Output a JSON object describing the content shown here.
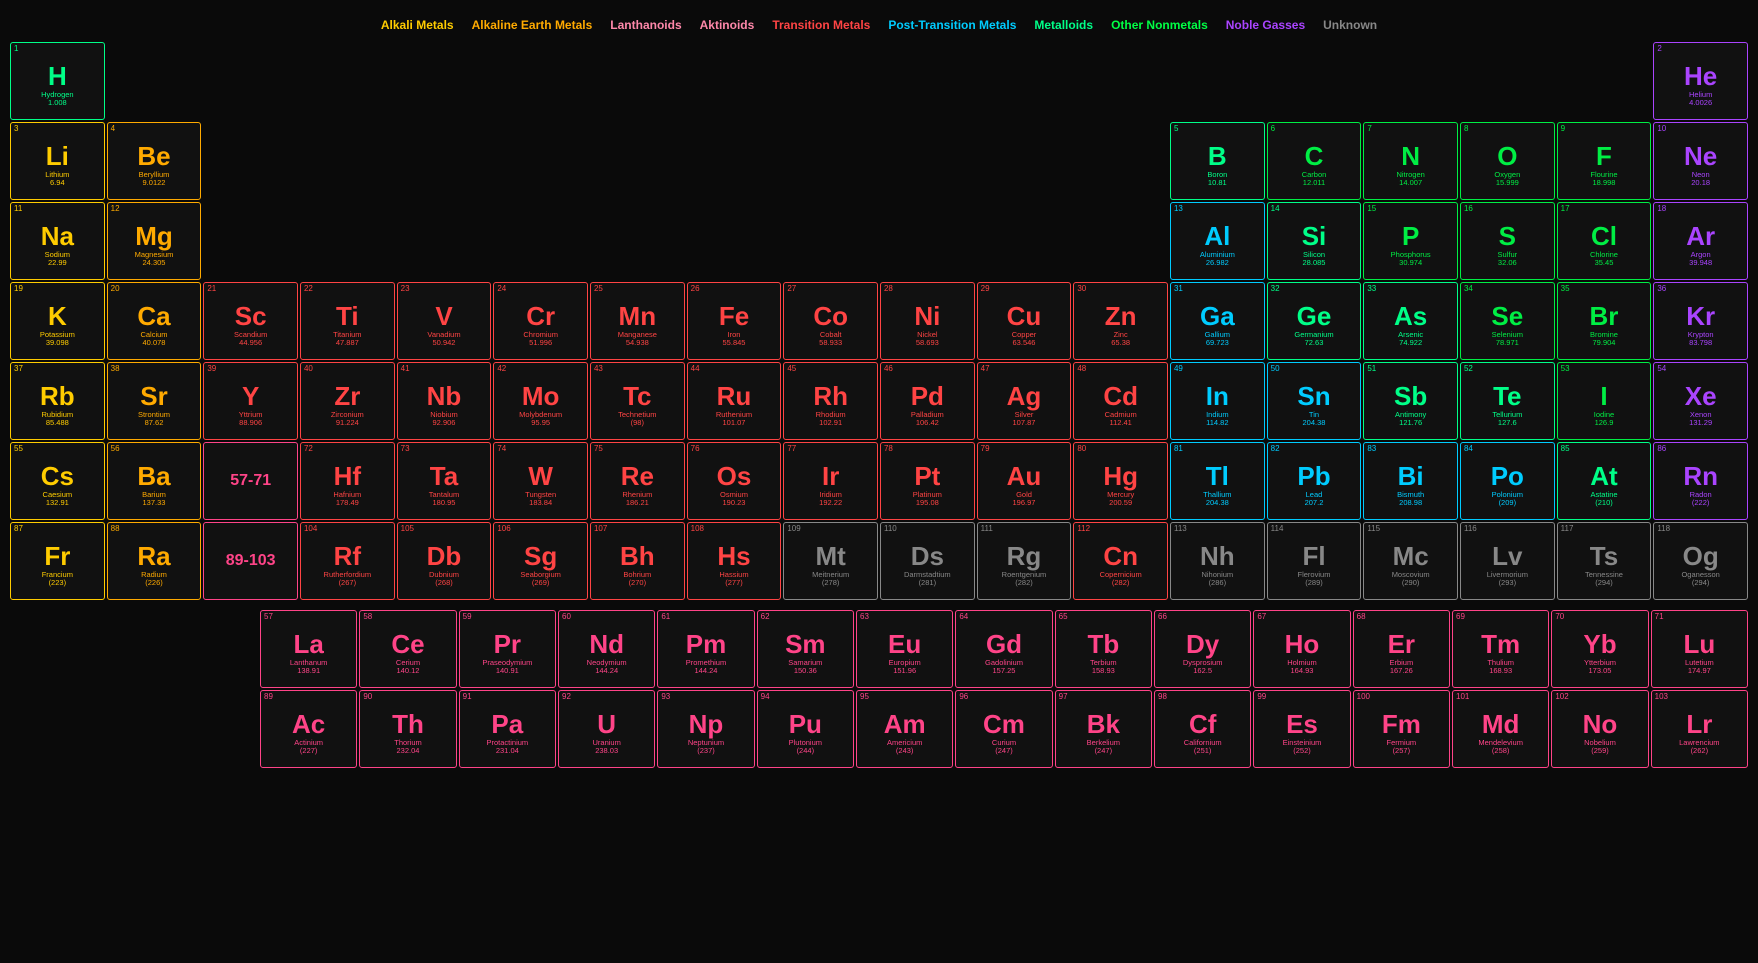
{
  "legend": {
    "items": [
      {
        "label": "Alkali Metals",
        "color": "#ffcc00",
        "key": "alkali"
      },
      {
        "label": "Alkaline Earth Metals",
        "color": "#ffaa00",
        "key": "alkali-earth"
      },
      {
        "label": "Lanthanoids",
        "color": "#ff88aa",
        "key": "lanthanoid"
      },
      {
        "label": "Aktinoids",
        "color": "#ff88aa",
        "key": "actinoid"
      },
      {
        "label": "Transition Metals",
        "color": "#ff4444",
        "key": "transition"
      },
      {
        "label": "Post-Transition Metals",
        "color": "#00ccff",
        "key": "post-transition"
      },
      {
        "label": "Metalloids",
        "color": "#00ff88",
        "key": "metalloid"
      },
      {
        "label": "Other Nonmetals",
        "color": "#00ff44",
        "key": "nonmetal"
      },
      {
        "label": "Noble Gasses",
        "color": "#aa44ff",
        "key": "noble"
      },
      {
        "label": "Unknown",
        "color": "#888888",
        "key": "unknown"
      }
    ]
  },
  "elements": [
    {
      "num": 1,
      "sym": "H",
      "name": "Hydrogen",
      "mass": "1.008",
      "cat": "hydrogen",
      "col": 1,
      "row": 1
    },
    {
      "num": 2,
      "sym": "He",
      "name": "Helium",
      "mass": "4.0026",
      "cat": "noble",
      "col": 18,
      "row": 1
    },
    {
      "num": 3,
      "sym": "Li",
      "name": "Lithium",
      "mass": "6.94",
      "cat": "alkali",
      "col": 1,
      "row": 2
    },
    {
      "num": 4,
      "sym": "Be",
      "name": "Beryllium",
      "mass": "9.0122",
      "cat": "alkali-earth",
      "col": 2,
      "row": 2
    },
    {
      "num": 5,
      "sym": "B",
      "name": "Boron",
      "mass": "10.81",
      "cat": "metalloid",
      "col": 13,
      "row": 2
    },
    {
      "num": 6,
      "sym": "C",
      "name": "Carbon",
      "mass": "12.011",
      "cat": "nonmetal",
      "col": 14,
      "row": 2
    },
    {
      "num": 7,
      "sym": "N",
      "name": "Nitrogen",
      "mass": "14.007",
      "cat": "nonmetal",
      "col": 15,
      "row": 2
    },
    {
      "num": 8,
      "sym": "O",
      "name": "Oxygen",
      "mass": "15.999",
      "cat": "nonmetal",
      "col": 16,
      "row": 2
    },
    {
      "num": 9,
      "sym": "F",
      "name": "Flourine",
      "mass": "18.998",
      "cat": "nonmetal",
      "col": 17,
      "row": 2
    },
    {
      "num": 10,
      "sym": "Ne",
      "name": "Neon",
      "mass": "20.18",
      "cat": "noble",
      "col": 18,
      "row": 2
    },
    {
      "num": 11,
      "sym": "Na",
      "name": "Sodium",
      "mass": "22.99",
      "cat": "alkali",
      "col": 1,
      "row": 3
    },
    {
      "num": 12,
      "sym": "Mg",
      "name": "Magnesium",
      "mass": "24.305",
      "cat": "alkali-earth",
      "col": 2,
      "row": 3
    },
    {
      "num": 13,
      "sym": "Al",
      "name": "Aluminium",
      "mass": "26.982",
      "cat": "post-transition",
      "col": 13,
      "row": 3
    },
    {
      "num": 14,
      "sym": "Si",
      "name": "Silicon",
      "mass": "28.085",
      "cat": "metalloid",
      "col": 14,
      "row": 3
    },
    {
      "num": 15,
      "sym": "P",
      "name": "Phosphorus",
      "mass": "30.974",
      "cat": "nonmetal",
      "col": 15,
      "row": 3
    },
    {
      "num": 16,
      "sym": "S",
      "name": "Sulfur",
      "mass": "32.06",
      "cat": "nonmetal",
      "col": 16,
      "row": 3
    },
    {
      "num": 17,
      "sym": "Cl",
      "name": "Chlorine",
      "mass": "35.45",
      "cat": "nonmetal",
      "col": 17,
      "row": 3
    },
    {
      "num": 18,
      "sym": "Ar",
      "name": "Argon",
      "mass": "39.948",
      "cat": "noble",
      "col": 18,
      "row": 3
    },
    {
      "num": 19,
      "sym": "K",
      "name": "Potassium",
      "mass": "39.098",
      "cat": "alkali",
      "col": 1,
      "row": 4
    },
    {
      "num": 20,
      "sym": "Ca",
      "name": "Calcium",
      "mass": "40.078",
      "cat": "alkali-earth",
      "col": 2,
      "row": 4
    },
    {
      "num": 21,
      "sym": "Sc",
      "name": "Scandium",
      "mass": "44.956",
      "cat": "transition",
      "col": 3,
      "row": 4
    },
    {
      "num": 22,
      "sym": "Ti",
      "name": "Titanium",
      "mass": "47.887",
      "cat": "transition",
      "col": 4,
      "row": 4
    },
    {
      "num": 23,
      "sym": "V",
      "name": "Vanadium",
      "mass": "50.942",
      "cat": "transition",
      "col": 5,
      "row": 4
    },
    {
      "num": 24,
      "sym": "Cr",
      "name": "Chromium",
      "mass": "51.996",
      "cat": "transition",
      "col": 6,
      "row": 4
    },
    {
      "num": 25,
      "sym": "Mn",
      "name": "Manganese",
      "mass": "54.938",
      "cat": "transition",
      "col": 7,
      "row": 4
    },
    {
      "num": 26,
      "sym": "Fe",
      "name": "Iron",
      "mass": "55.845",
      "cat": "transition",
      "col": 8,
      "row": 4
    },
    {
      "num": 27,
      "sym": "Co",
      "name": "Cobalt",
      "mass": "58.933",
      "cat": "transition",
      "col": 9,
      "row": 4
    },
    {
      "num": 28,
      "sym": "Ni",
      "name": "Nickel",
      "mass": "58.693",
      "cat": "transition",
      "col": 10,
      "row": 4
    },
    {
      "num": 29,
      "sym": "Cu",
      "name": "Copper",
      "mass": "63.546",
      "cat": "transition",
      "col": 11,
      "row": 4
    },
    {
      "num": 30,
      "sym": "Zn",
      "name": "Zinc",
      "mass": "65.38",
      "cat": "transition",
      "col": 12,
      "row": 4
    },
    {
      "num": 31,
      "sym": "Ga",
      "name": "Gallium",
      "mass": "69.723",
      "cat": "post-transition",
      "col": 13,
      "row": 4
    },
    {
      "num": 32,
      "sym": "Ge",
      "name": "Germanium",
      "mass": "72.63",
      "cat": "metalloid",
      "col": 14,
      "row": 4
    },
    {
      "num": 33,
      "sym": "As",
      "name": "Arsenic",
      "mass": "74.922",
      "cat": "metalloid",
      "col": 15,
      "row": 4
    },
    {
      "num": 34,
      "sym": "Se",
      "name": "Selenium",
      "mass": "78.971",
      "cat": "nonmetal",
      "col": 16,
      "row": 4
    },
    {
      "num": 35,
      "sym": "Br",
      "name": "Bromine",
      "mass": "79.904",
      "cat": "nonmetal",
      "col": 17,
      "row": 4
    },
    {
      "num": 36,
      "sym": "Kr",
      "name": "Krypton",
      "mass": "83.798",
      "cat": "noble",
      "col": 18,
      "row": 4
    },
    {
      "num": 37,
      "sym": "Rb",
      "name": "Rubidium",
      "mass": "85.488",
      "cat": "alkali",
      "col": 1,
      "row": 5
    },
    {
      "num": 38,
      "sym": "Sr",
      "name": "Strontium",
      "mass": "87.62",
      "cat": "alkali-earth",
      "col": 2,
      "row": 5
    },
    {
      "num": 39,
      "sym": "Y",
      "name": "Yttrium",
      "mass": "88.906",
      "cat": "transition",
      "col": 3,
      "row": 5
    },
    {
      "num": 40,
      "sym": "Zr",
      "name": "Zirconium",
      "mass": "91.224",
      "cat": "transition",
      "col": 4,
      "row": 5
    },
    {
      "num": 41,
      "sym": "Nb",
      "name": "Niobium",
      "mass": "92.906",
      "cat": "transition",
      "col": 5,
      "row": 5
    },
    {
      "num": 42,
      "sym": "Mo",
      "name": "Molybdenum",
      "mass": "95.95",
      "cat": "transition",
      "col": 6,
      "row": 5
    },
    {
      "num": 43,
      "sym": "Tc",
      "name": "Technetium",
      "mass": "(98)",
      "cat": "transition",
      "col": 7,
      "row": 5
    },
    {
      "num": 44,
      "sym": "Ru",
      "name": "Ruthenium",
      "mass": "101.07",
      "cat": "transition",
      "col": 8,
      "row": 5
    },
    {
      "num": 45,
      "sym": "Rh",
      "name": "Rhodium",
      "mass": "102.91",
      "cat": "transition",
      "col": 9,
      "row": 5
    },
    {
      "num": 46,
      "sym": "Pd",
      "name": "Palladium",
      "mass": "106.42",
      "cat": "transition",
      "col": 10,
      "row": 5
    },
    {
      "num": 47,
      "sym": "Ag",
      "name": "Silver",
      "mass": "107.87",
      "cat": "transition",
      "col": 11,
      "row": 5
    },
    {
      "num": 48,
      "sym": "Cd",
      "name": "Cadmium",
      "mass": "112.41",
      "cat": "transition",
      "col": 12,
      "row": 5
    },
    {
      "num": 49,
      "sym": "In",
      "name": "Indium",
      "mass": "114.82",
      "cat": "post-transition",
      "col": 13,
      "row": 5
    },
    {
      "num": 50,
      "sym": "Sn",
      "name": "Tin",
      "mass": "204.38",
      "cat": "post-transition",
      "col": 14,
      "row": 5
    },
    {
      "num": 51,
      "sym": "Sb",
      "name": "Antimony",
      "mass": "121.76",
      "cat": "metalloid",
      "col": 15,
      "row": 5
    },
    {
      "num": 52,
      "sym": "Te",
      "name": "Tellurium",
      "mass": "127.6",
      "cat": "metalloid",
      "col": 16,
      "row": 5
    },
    {
      "num": 53,
      "sym": "I",
      "name": "Iodine",
      "mass": "126.9",
      "cat": "nonmetal",
      "col": 17,
      "row": 5
    },
    {
      "num": 54,
      "sym": "Xe",
      "name": "Xenon",
      "mass": "131.29",
      "cat": "noble",
      "col": 18,
      "row": 5
    },
    {
      "num": 55,
      "sym": "Cs",
      "name": "Caesium",
      "mass": "132.91",
      "cat": "alkali",
      "col": 1,
      "row": 6
    },
    {
      "num": 56,
      "sym": "Ba",
      "name": "Barium",
      "mass": "137.33",
      "cat": "alkali-earth",
      "col": 2,
      "row": 6
    },
    {
      "num": 72,
      "sym": "Hf",
      "name": "Hafnium",
      "mass": "178.49",
      "cat": "transition",
      "col": 4,
      "row": 6
    },
    {
      "num": 73,
      "sym": "Ta",
      "name": "Tantalum",
      "mass": "180.95",
      "cat": "transition",
      "col": 5,
      "row": 6
    },
    {
      "num": 74,
      "sym": "W",
      "name": "Tungsten",
      "mass": "183.84",
      "cat": "transition",
      "col": 6,
      "row": 6
    },
    {
      "num": 75,
      "sym": "Re",
      "name": "Rhenium",
      "mass": "186.21",
      "cat": "transition",
      "col": 7,
      "row": 6
    },
    {
      "num": 76,
      "sym": "Os",
      "name": "Osmium",
      "mass": "190.23",
      "cat": "transition",
      "col": 8,
      "row": 6
    },
    {
      "num": 77,
      "sym": "Ir",
      "name": "Iridium",
      "mass": "192.22",
      "cat": "transition",
      "col": 9,
      "row": 6
    },
    {
      "num": 78,
      "sym": "Pt",
      "name": "Platinum",
      "mass": "195.08",
      "cat": "transition",
      "col": 10,
      "row": 6
    },
    {
      "num": 79,
      "sym": "Au",
      "name": "Gold",
      "mass": "196.97",
      "cat": "transition",
      "col": 11,
      "row": 6
    },
    {
      "num": 80,
      "sym": "Hg",
      "name": "Mercury",
      "mass": "200.59",
      "cat": "transition",
      "col": 12,
      "row": 6
    },
    {
      "num": 81,
      "sym": "Tl",
      "name": "Thallium",
      "mass": "204.38",
      "cat": "post-transition",
      "col": 13,
      "row": 6
    },
    {
      "num": 82,
      "sym": "Pb",
      "name": "Lead",
      "mass": "207.2",
      "cat": "post-transition",
      "col": 14,
      "row": 6
    },
    {
      "num": 83,
      "sym": "Bi",
      "name": "Bismuth",
      "mass": "208.98",
      "cat": "post-transition",
      "col": 15,
      "row": 6
    },
    {
      "num": 84,
      "sym": "Po",
      "name": "Polonium",
      "mass": "(209)",
      "cat": "post-transition",
      "col": 16,
      "row": 6
    },
    {
      "num": 85,
      "sym": "At",
      "name": "Astatine",
      "mass": "(210)",
      "cat": "metalloid",
      "col": 17,
      "row": 6
    },
    {
      "num": 86,
      "sym": "Rn",
      "name": "Radon",
      "mass": "(222)",
      "cat": "noble",
      "col": 18,
      "row": 6
    },
    {
      "num": 87,
      "sym": "Fr",
      "name": "Francium",
      "mass": "(223)",
      "cat": "alkali",
      "col": 1,
      "row": 7
    },
    {
      "num": 88,
      "sym": "Ra",
      "name": "Radium",
      "mass": "(226)",
      "cat": "alkali-earth",
      "col": 2,
      "row": 7
    },
    {
      "num": 104,
      "sym": "Rf",
      "name": "Rutherfordium",
      "mass": "(267)",
      "cat": "transition",
      "col": 4,
      "row": 7
    },
    {
      "num": 105,
      "sym": "Db",
      "name": "Dubnium",
      "mass": "(268)",
      "cat": "transition",
      "col": 5,
      "row": 7
    },
    {
      "num": 106,
      "sym": "Sg",
      "name": "Seaborgium",
      "mass": "(269)",
      "cat": "transition",
      "col": 6,
      "row": 7
    },
    {
      "num": 107,
      "sym": "Bh",
      "name": "Bohrium",
      "mass": "(270)",
      "cat": "transition",
      "col": 7,
      "row": 7
    },
    {
      "num": 108,
      "sym": "Hs",
      "name": "Hassium",
      "mass": "(277)",
      "cat": "transition",
      "col": 8,
      "row": 7
    },
    {
      "num": 109,
      "sym": "Mt",
      "name": "Meitnerium",
      "mass": "(278)",
      "cat": "unknown",
      "col": 9,
      "row": 7
    },
    {
      "num": 110,
      "sym": "Ds",
      "name": "Darmstadtium",
      "mass": "(281)",
      "cat": "unknown",
      "col": 10,
      "row": 7
    },
    {
      "num": 111,
      "sym": "Rg",
      "name": "Roentgenium",
      "mass": "(282)",
      "cat": "unknown",
      "col": 11,
      "row": 7
    },
    {
      "num": 112,
      "sym": "Cn",
      "name": "Copernicium",
      "mass": "(282)",
      "cat": "transition",
      "col": 12,
      "row": 7
    },
    {
      "num": 113,
      "sym": "Nh",
      "name": "Nihonium",
      "mass": "(286)",
      "cat": "unknown",
      "col": 13,
      "row": 7
    },
    {
      "num": 114,
      "sym": "Fl",
      "name": "Flerovium",
      "mass": "(289)",
      "cat": "unknown",
      "col": 14,
      "row": 7
    },
    {
      "num": 115,
      "sym": "Mc",
      "name": "Moscovium",
      "mass": "(290)",
      "cat": "unknown",
      "col": 15,
      "row": 7
    },
    {
      "num": 116,
      "sym": "Lv",
      "name": "Livermorium",
      "mass": "(293)",
      "cat": "unknown",
      "col": 16,
      "row": 7
    },
    {
      "num": 117,
      "sym": "Ts",
      "name": "Tennessine",
      "mass": "(294)",
      "cat": "unknown",
      "col": 17,
      "row": 7
    },
    {
      "num": 118,
      "sym": "Og",
      "name": "Oganesson",
      "mass": "(294)",
      "cat": "unknown",
      "col": 18,
      "row": 7
    }
  ],
  "lanthanides": [
    {
      "num": 57,
      "sym": "La",
      "name": "Lanthanum",
      "mass": "138.91",
      "cat": "lanthanoid"
    },
    {
      "num": 58,
      "sym": "Ce",
      "name": "Cerium",
      "mass": "140.12",
      "cat": "lanthanoid"
    },
    {
      "num": 59,
      "sym": "Pr",
      "name": "Praseodymium",
      "mass": "140.91",
      "cat": "lanthanoid"
    },
    {
      "num": 60,
      "sym": "Nd",
      "name": "Neodymium",
      "mass": "144.24",
      "cat": "lanthanoid"
    },
    {
      "num": 61,
      "sym": "Pm",
      "name": "Promethium",
      "mass": "144.24",
      "cat": "lanthanoid"
    },
    {
      "num": 62,
      "sym": "Sm",
      "name": "Samarium",
      "mass": "150.36",
      "cat": "lanthanoid"
    },
    {
      "num": 63,
      "sym": "Eu",
      "name": "Europium",
      "mass": "151.96",
      "cat": "lanthanoid"
    },
    {
      "num": 64,
      "sym": "Gd",
      "name": "Gadolinium",
      "mass": "157.25",
      "cat": "lanthanoid"
    },
    {
      "num": 65,
      "sym": "Tb",
      "name": "Terbium",
      "mass": "158.93",
      "cat": "lanthanoid"
    },
    {
      "num": 66,
      "sym": "Dy",
      "name": "Dysprosium",
      "mass": "162.5",
      "cat": "lanthanoid"
    },
    {
      "num": 67,
      "sym": "Ho",
      "name": "Holmium",
      "mass": "164.93",
      "cat": "lanthanoid"
    },
    {
      "num": 68,
      "sym": "Er",
      "name": "Erbium",
      "mass": "167.26",
      "cat": "lanthanoid"
    },
    {
      "num": 69,
      "sym": "Tm",
      "name": "Thulium",
      "mass": "168.93",
      "cat": "lanthanoid"
    },
    {
      "num": 70,
      "sym": "Yb",
      "name": "Ytterbium",
      "mass": "173.05",
      "cat": "lanthanoid"
    },
    {
      "num": 71,
      "sym": "Lu",
      "name": "Lutetium",
      "mass": "174.97",
      "cat": "lanthanoid"
    }
  ],
  "actinides": [
    {
      "num": 89,
      "sym": "Ac",
      "name": "Actinium",
      "mass": "(227)",
      "cat": "actinoid"
    },
    {
      "num": 90,
      "sym": "Th",
      "name": "Thorium",
      "mass": "232.04",
      "cat": "actinoid"
    },
    {
      "num": 91,
      "sym": "Pa",
      "name": "Protactinium",
      "mass": "231.04",
      "cat": "actinoid"
    },
    {
      "num": 92,
      "sym": "U",
      "name": "Uranium",
      "mass": "238.03",
      "cat": "actinoid"
    },
    {
      "num": 93,
      "sym": "Np",
      "name": "Neptunium",
      "mass": "(237)",
      "cat": "actinoid"
    },
    {
      "num": 94,
      "sym": "Pu",
      "name": "Plutonium",
      "mass": "(244)",
      "cat": "actinoid"
    },
    {
      "num": 95,
      "sym": "Am",
      "name": "Americium",
      "mass": "(243)",
      "cat": "actinoid"
    },
    {
      "num": 96,
      "sym": "Cm",
      "name": "Curium",
      "mass": "(247)",
      "cat": "actinoid"
    },
    {
      "num": 97,
      "sym": "Bk",
      "name": "Berkelium",
      "mass": "(247)",
      "cat": "actinoid"
    },
    {
      "num": 98,
      "sym": "Cf",
      "name": "Californium",
      "mass": "(251)",
      "cat": "actinoid"
    },
    {
      "num": 99,
      "sym": "Es",
      "name": "Einsteinium",
      "mass": "(252)",
      "cat": "actinoid"
    },
    {
      "num": 100,
      "sym": "Fm",
      "name": "Fermium",
      "mass": "(257)",
      "cat": "actinoid"
    },
    {
      "num": 101,
      "sym": "Md",
      "name": "Mendelevium",
      "mass": "(258)",
      "cat": "actinoid"
    },
    {
      "num": 102,
      "sym": "No",
      "name": "Nobelium",
      "mass": "(259)",
      "cat": "actinoid"
    },
    {
      "num": 103,
      "sym": "Lr",
      "name": "Lawrencium",
      "mass": "(262)",
      "cat": "actinoid"
    }
  ]
}
